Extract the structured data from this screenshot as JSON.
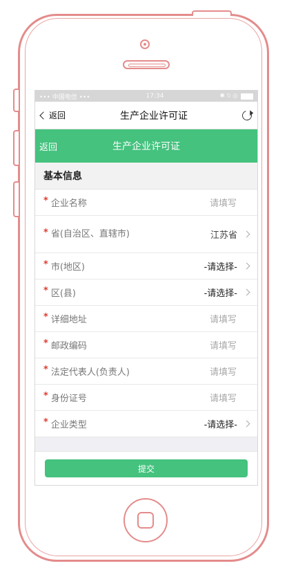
{
  "status": {
    "carrier": "••• 中国电信 •••",
    "time": "17:34",
    "icons": "✱ ⍉ ◎"
  },
  "navbar": {
    "back": "返回",
    "title": "生产企业许可证"
  },
  "greenbar": {
    "back": "返回",
    "title": "生产企业许可证"
  },
  "section": "基本信息",
  "rows": [
    {
      "star": "*",
      "label": "企业名称",
      "value": "请填写"
    },
    {
      "star": "*",
      "label": "省(自治区、直辖市)",
      "value": "江苏省"
    },
    {
      "star": "*",
      "label": "市(地区)",
      "value": "-请选择-"
    },
    {
      "star": "*",
      "label": "区(县)",
      "value": "-请选择-"
    },
    {
      "star": "*",
      "label": "详细地址",
      "value": "请填写"
    },
    {
      "star": "*",
      "label": "邮政编码",
      "value": "请填写"
    },
    {
      "star": "*",
      "label": "法定代表人(负责人)",
      "value": "请填写"
    },
    {
      "star": "*",
      "label": "身份证号",
      "value": "请填写"
    },
    {
      "star": "*",
      "label": "企业类型",
      "value": "-请选择-"
    }
  ],
  "submit": "提交",
  "colors": {
    "accent": "#44c27e",
    "required": "#e03b2f",
    "frame": "#e48b8b"
  }
}
